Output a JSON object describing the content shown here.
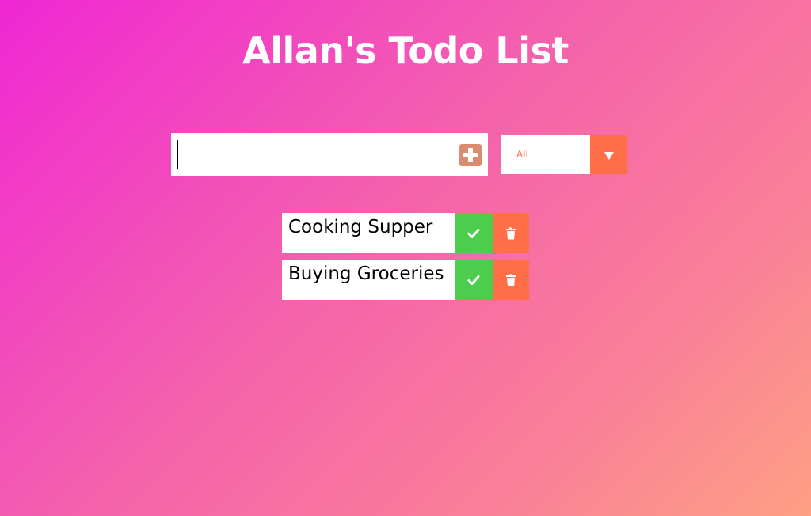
{
  "header": {
    "title": "Allan's Todo List"
  },
  "form": {
    "input_value": "",
    "input_placeholder": "",
    "add_icon": "plus-square-icon"
  },
  "filter": {
    "selected": "All",
    "arrow_icon": "caret-down-icon"
  },
  "todos": [
    {
      "text": "Cooking Supper",
      "complete_icon": "check-icon",
      "delete_icon": "trash-icon"
    },
    {
      "text": "Buying Groceries",
      "complete_icon": "check-icon",
      "delete_icon": "trash-icon"
    }
  ],
  "colors": {
    "accent": "#ff6f47",
    "complete": "#4dcd4d",
    "add_button": "#db8b6f",
    "gradient_start": "#f027d4",
    "gradient_end": "#fda084"
  }
}
